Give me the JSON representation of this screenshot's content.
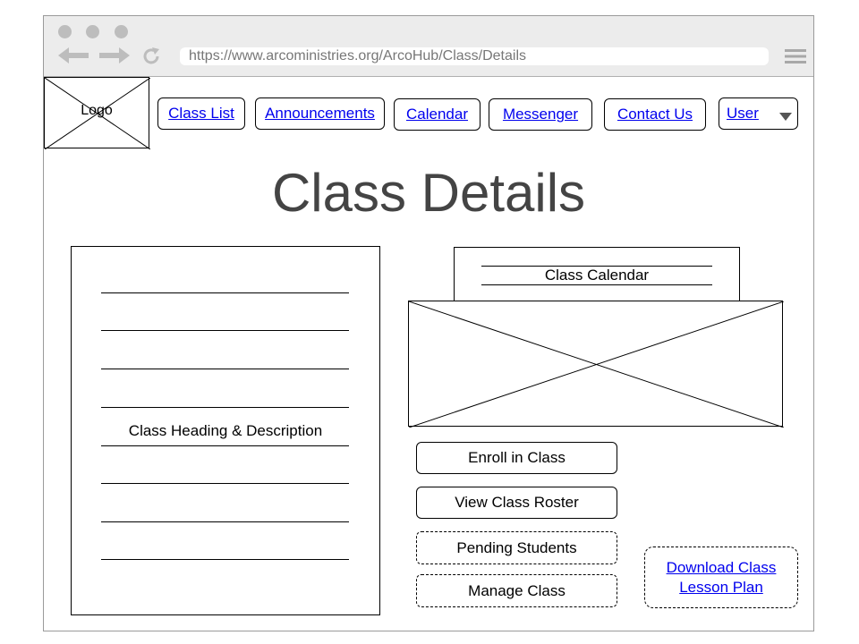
{
  "browser": {
    "url": "https://www.arcoministries.org/ArcoHub/Class/Details"
  },
  "logo": {
    "label": "Logo"
  },
  "nav": {
    "class_list": "Class List",
    "announcements": "Announcements",
    "calendar": "Calendar",
    "messenger": "Messenger",
    "contact_us": "Contact Us",
    "user": "User"
  },
  "page": {
    "title": "Class Details"
  },
  "class_info": {
    "heading": "Class Heading & Description"
  },
  "calendar_panel": {
    "label": "Class Calendar"
  },
  "actions": {
    "enroll": "Enroll in Class",
    "view_roster": "View Class Roster",
    "pending_students": "Pending Students",
    "manage_class": "Manage Class",
    "download_lesson_plan": "Download Class Lesson Plan"
  },
  "icons": {
    "back": "arrow-left-icon",
    "forward": "arrow-right-icon",
    "reload": "reload-icon",
    "menu": "hamburger-menu-icon",
    "user_dropdown": "caret-down-icon"
  },
  "colors": {
    "link": "#0000ee",
    "chrome": "#ececec",
    "title": "#444444"
  }
}
